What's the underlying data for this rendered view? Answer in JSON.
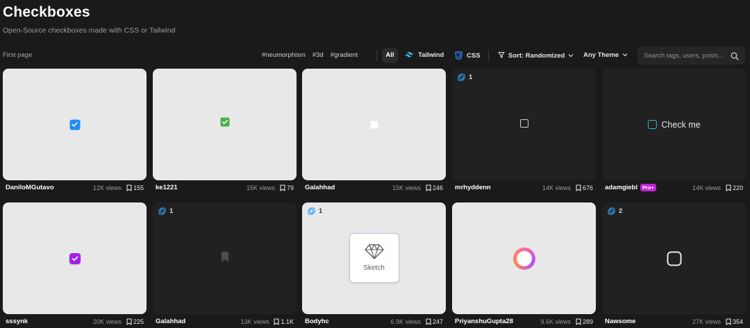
{
  "header": {
    "title": "Checkboxes",
    "subtitle": "Open-Source checkboxes made with CSS or Tailwind"
  },
  "toolbar": {
    "first_page": "First page",
    "tags": [
      "#neumorphism",
      "#3d",
      "#gradient"
    ],
    "filters": {
      "all": "All",
      "tailwind": "Tailwind",
      "css": "CSS"
    },
    "sort_label": "Sort: Randomized",
    "theme_label": "Any Theme",
    "search_placeholder": "Search tags, users, posts..."
  },
  "colors": {
    "background": "#1a1a1a",
    "card_light": "#e8e8e8",
    "card_dark": "#212121",
    "tailwind": "#38bdf8",
    "css": "#2b7fff",
    "variant_icon": "#2b9df8",
    "pro_badge": "#c224d8"
  },
  "cards": [
    {
      "author": "DaniloMGutavo",
      "views": "12K views",
      "bookmarks": "155",
      "theme": "light",
      "variants": "",
      "preview": "blue-checked-checkbox"
    },
    {
      "author": "ke1221",
      "views": "15K views",
      "bookmarks": "79",
      "theme": "light",
      "variants": "",
      "preview": "green-checked-checkbox"
    },
    {
      "author": "Galahhad",
      "views": "15K views",
      "bookmarks": "246",
      "theme": "light",
      "variants": "",
      "preview": "white-square-checkbox"
    },
    {
      "author": "mrhyddenn",
      "views": "14K views",
      "bookmarks": "676",
      "theme": "dark",
      "variants": "1",
      "preview": "outline-checkbox"
    },
    {
      "author": "adamgiebl",
      "views": "14K views",
      "bookmarks": "220",
      "theme": "dark",
      "variants": "",
      "pro": "Pro+",
      "preview": "check-me-checkbox",
      "preview_text": "Check me"
    },
    {
      "author": "sssynk",
      "views": "20K views",
      "bookmarks": "225",
      "theme": "light",
      "variants": "",
      "preview": "purple-checked-checkbox"
    },
    {
      "author": "Galahhad",
      "views": "13K views",
      "bookmarks": "1.1K",
      "theme": "dark",
      "variants": "1",
      "preview": "bookmark-checkbox"
    },
    {
      "author": "Bodyhc",
      "views": "6.9K views",
      "bookmarks": "247",
      "theme": "light",
      "variants": "1",
      "preview": "sketch-checkbox",
      "preview_text": "Sketch"
    },
    {
      "author": "PriyanshuGupta28",
      "views": "9.6K views",
      "bookmarks": "289",
      "theme": "light",
      "variants": "",
      "preview": "gradient-ring-checkbox"
    },
    {
      "author": "Nawsome",
      "views": "27K views",
      "bookmarks": "354",
      "theme": "dark",
      "variants": "2",
      "preview": "rounded-outline-checkbox"
    }
  ]
}
